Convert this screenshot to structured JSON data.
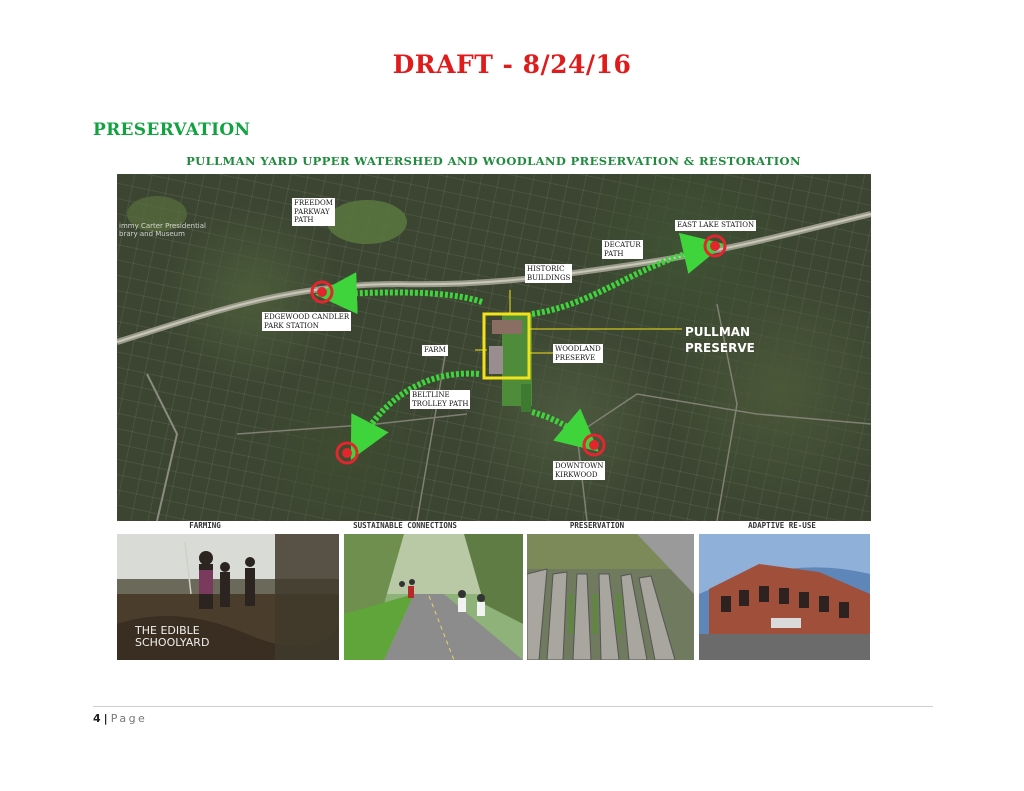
{
  "header": {
    "draft_label": "DRAFT - 8/24/16"
  },
  "section": {
    "heading": "PRESERVATION"
  },
  "figure": {
    "title": "PULLMAN YARD UPPER WATERSHED AND WOODLAND PRESERVATION & RESTORATION",
    "map_labels": {
      "freedom_parkway_path": "FREEDOM\nPARKWAY\nPATH",
      "east_lake_station": "EAST LAKE STATION",
      "decatur_path": "DECATUR\nPATH",
      "historic_buildings": "HISTORIC\nBUILDINGS",
      "edgewood_candler_park_station": "EDGEWOOD CANDLER\nPARK STATION",
      "farm": "FARM",
      "woodland_preserve": "WOODLAND\nPRESERVE",
      "beltline_trolley_path": "BELTLINE\nTROLLEY PATH",
      "downtown_kirkwood": "DOWNTOWN\nKIRKWOOD",
      "pullman_preserve": "PULLMAN\nPRESERVE",
      "jimmy_carter_library": "immy Carter Presidential\nbrary and Museum"
    },
    "photo_captions": [
      "FARMING",
      "SUSTAINABLE CONNECTIONS",
      "PRESERVATION",
      "ADAPTIVE RE-USE"
    ],
    "photo_texts": {
      "edible_schoolyard": "THE EDIBLE\nSCHOOLYARD"
    }
  },
  "footer": {
    "page_number": "4",
    "separator": "|",
    "page_word": "Page"
  },
  "colors": {
    "draft_red": "#e01b1b",
    "section_green": "#12a340",
    "path_green": "#3fd33c",
    "marker_red": "#e3262e",
    "boundary_yellow": "#f2e21a"
  }
}
